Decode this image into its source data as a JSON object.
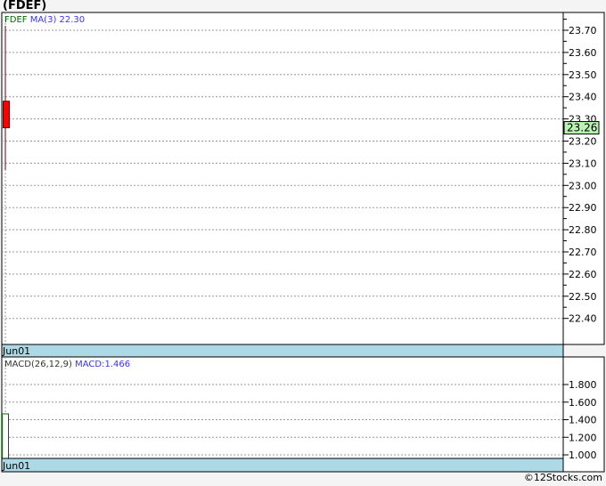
{
  "title": "(FDEF)",
  "credit": "©12Stocks.com",
  "chart_data": [
    {
      "type": "candlestick",
      "legend": {
        "symbol": "FDEF",
        "ma_label": "MA(3)",
        "ma_value": "22.30"
      },
      "categories": [
        "Jun01"
      ],
      "ohlc": [
        {
          "date": "Jun01",
          "open": 23.38,
          "high": 23.72,
          "low": 23.07,
          "close": 23.26
        }
      ],
      "last_price": "23.26",
      "ylim": [
        22.28,
        23.78
      ],
      "yticks": [
        "23.70",
        "23.60",
        "23.50",
        "23.40",
        "23.30",
        "23.20",
        "23.10",
        "23.00",
        "22.90",
        "22.80",
        "22.70",
        "22.60",
        "22.50",
        "22.40"
      ],
      "grid": true,
      "colors": {
        "down": "#ff0000",
        "wick": "#660000",
        "last_price_bg": "#b8f5b0",
        "date_bar": "#add8e6"
      }
    },
    {
      "type": "bar",
      "legend": {
        "label": "MACD(26,12,9)",
        "value_label": "MACD:1.466"
      },
      "categories": [
        "Jun01"
      ],
      "values": [
        1.466
      ],
      "ylim": [
        0.96,
        2.0
      ],
      "yticks": [
        "1.800",
        "1.600",
        "1.400",
        "1.200",
        "1.000"
      ],
      "grid": true,
      "colors": {
        "bar": "#006600"
      }
    }
  ]
}
